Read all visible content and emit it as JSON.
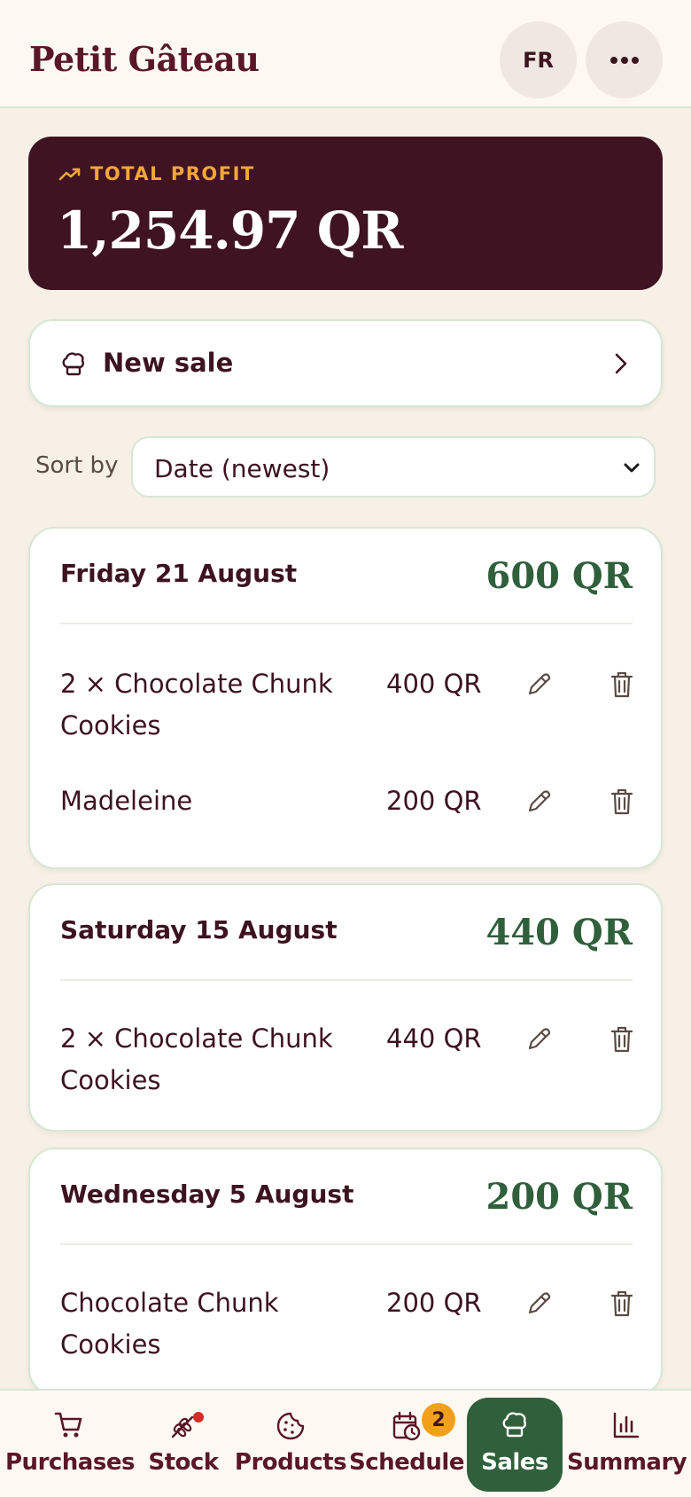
{
  "header": {
    "brand": "Petit Gâteau",
    "lang_label": "FR",
    "more_label": "•••"
  },
  "profit": {
    "label": "TOTAL PROFIT",
    "value": "1,254.97 QR"
  },
  "new_sale": {
    "label": "New sale"
  },
  "sort": {
    "label": "Sort by",
    "selected": "Date (newest)"
  },
  "days": [
    {
      "date": "Friday 21 August",
      "total": "600 QR",
      "items": [
        {
          "name": "2 × Chocolate Chunk Cookies",
          "price": "400 QR"
        },
        {
          "name": "Madeleine",
          "price": "200 QR"
        }
      ]
    },
    {
      "date": "Saturday 15 August",
      "total": "440 QR",
      "items": [
        {
          "name": "2 × Chocolate Chunk Cookies",
          "price": "440 QR"
        }
      ]
    },
    {
      "date": "Wednesday 5 August",
      "total": "200 QR",
      "items": [
        {
          "name": "Chocolate Chunk Cookies",
          "price": "200 QR"
        }
      ]
    }
  ],
  "nav": {
    "items": [
      {
        "label": "Purchases",
        "icon": "cart-icon"
      },
      {
        "label": "Stock",
        "icon": "wheat-icon"
      },
      {
        "label": "Products",
        "icon": "cookie-icon"
      },
      {
        "label": "Schedule",
        "icon": "calendar-clock-icon",
        "badge": "2"
      },
      {
        "label": "Sales",
        "icon": "chef-hat-icon",
        "active": true
      },
      {
        "label": "Summary",
        "icon": "bar-chart-icon"
      }
    ]
  },
  "colors": {
    "brand": "#5a1728",
    "profit_bg": "#3f1321",
    "accent_orange": "#f2a53a",
    "green": "#2f5f3b",
    "badge": "#f2a01c",
    "alert_dot": "#d62b2b"
  }
}
